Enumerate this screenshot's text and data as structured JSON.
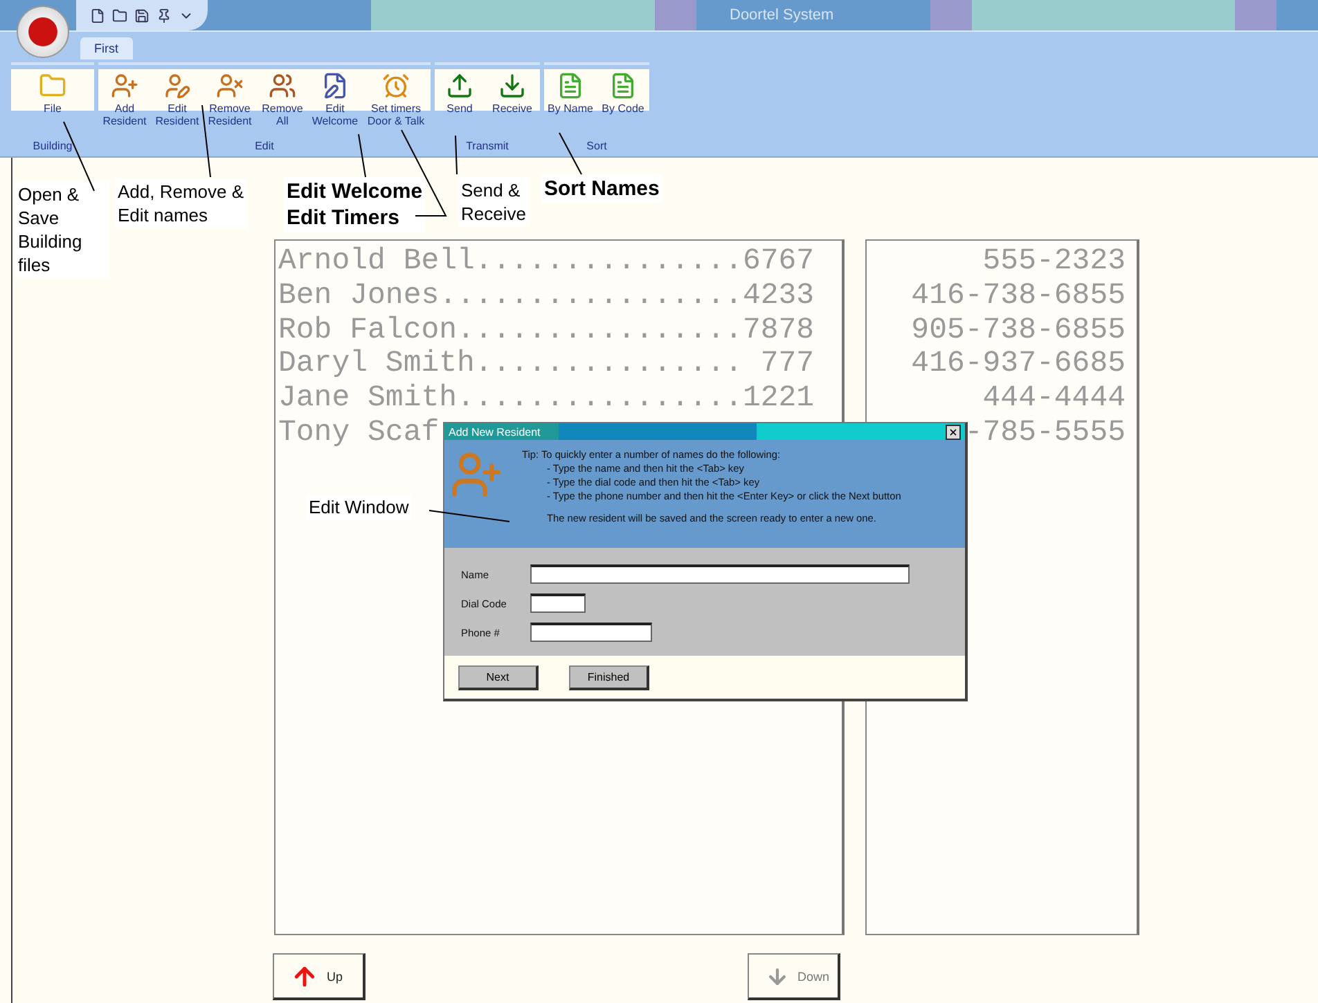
{
  "window": {
    "title": "Doortel System"
  },
  "quick_access": [
    {
      "kind": "new"
    },
    {
      "kind": "open"
    },
    {
      "kind": "save"
    },
    {
      "kind": "pin"
    },
    {
      "kind": "more"
    }
  ],
  "tabs": [
    {
      "label": "First",
      "selected": true
    }
  ],
  "ribbon_groups": [
    {
      "title": "Building",
      "buttons": [
        {
          "label": "File",
          "kind": "folder"
        }
      ]
    },
    {
      "title": "Edit",
      "buttons": [
        {
          "label": "Add Resident",
          "kind": "add"
        },
        {
          "label": "Edit Resident",
          "kind": "edit"
        },
        {
          "label": "Remove Resident",
          "kind": "remove"
        },
        {
          "label": "Remove All",
          "kind": "remove_all"
        },
        {
          "label": "Edit Welcome",
          "kind": "welcome"
        },
        {
          "label": "Set timers Door & Talk",
          "kind": "timer"
        }
      ]
    },
    {
      "title": "Transmit",
      "buttons": [
        {
          "label": "Send",
          "kind": "send"
        },
        {
          "label": "Receive",
          "kind": "receive"
        }
      ]
    },
    {
      "title": "Sort",
      "buttons": [
        {
          "label": "By Name",
          "kind": "sort"
        },
        {
          "label": "By Code",
          "kind": "sort"
        }
      ]
    }
  ],
  "annotations": [
    {
      "lines": [
        "Open &",
        "Save",
        "Building",
        "files"
      ],
      "bold": false
    },
    {
      "lines": [
        "Add, Remove &",
        "Edit names"
      ],
      "bold": false
    },
    {
      "lines": [
        "Edit Welcome",
        "Edit Timers"
      ],
      "bold": true
    },
    {
      "lines": [
        "Send &",
        "Receive"
      ],
      "bold": false
    },
    {
      "lines": [
        "Sort Names"
      ],
      "bold": true
    },
    {
      "lines": [
        "Edit Window"
      ],
      "bold": false
    }
  ],
  "names": [
    "Arnold Bell...............6767",
    "Ben Jones.................4233",
    "Rob Falcon................7878",
    "Daryl Smith............... 777",
    "Jane Smith................1221",
    "Tony Scaf"
  ],
  "phones": [
    "555-2323",
    "416-738-6855",
    "905-738-6855",
    "416-937-6685",
    "444-4444",
    "-785-5555"
  ],
  "dialog": {
    "title": "Add New Resident",
    "tip": [
      "Tip: To quickly enter a number of names do the following:",
      "- Type the name and then hit the <Tab> key",
      "- Type the dial code and then hit the <Tab> key",
      "- Type the phone number and then hit the <Enter Key> or click the Next button"
    ],
    "note": "The new resident will be saved and the screen ready to enter a new one.",
    "fields": [
      {
        "label": "Name",
        "kind": "long"
      },
      {
        "label": "Dial Code",
        "kind": "short"
      },
      {
        "label": "Phone #",
        "kind": "medium"
      }
    ],
    "buttons": [
      "Next",
      "Finished"
    ]
  },
  "nav_buttons": [
    {
      "label": "Up",
      "kind": "up",
      "disabled": false
    },
    {
      "label": "Down",
      "kind": "down",
      "disabled": true
    }
  ]
}
